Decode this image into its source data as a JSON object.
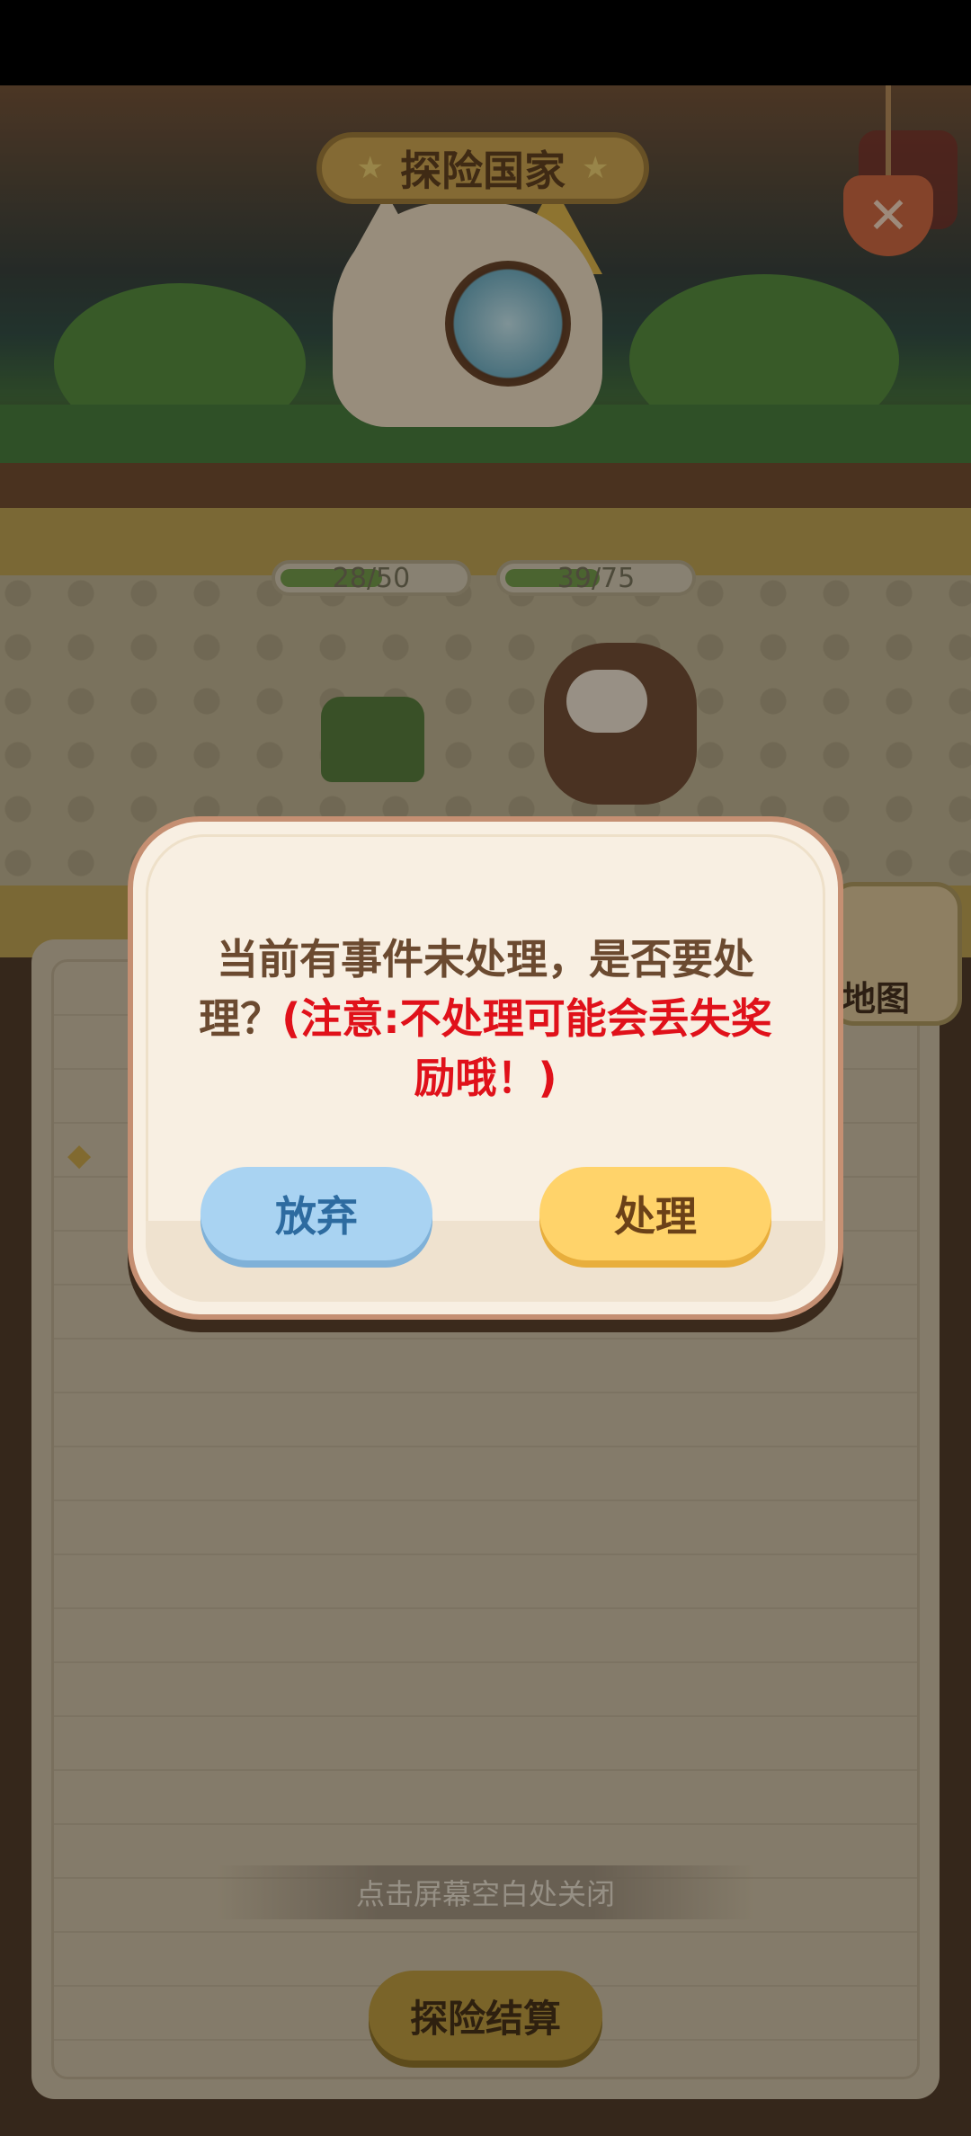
{
  "header": {
    "title": "探险国家"
  },
  "battle": {
    "enemy_hp": {
      "text": "28/50",
      "current": 28,
      "max": 50
    },
    "player_hp": {
      "text": "39/75",
      "current": 39,
      "max": 75
    }
  },
  "side": {
    "map_label": "地图"
  },
  "panel": {
    "hint": "点击屏幕空白处关闭",
    "settle_label": "探险结算"
  },
  "dialog": {
    "message": "当前有事件未处理，是否要处理？",
    "warning": "(注意:不处理可能会丢失奖励哦！)",
    "abandon_label": "放弃",
    "handle_label": "处理"
  },
  "colors": {
    "warning": "#e0111a",
    "abandon_button": "#a9d3f2",
    "handle_button": "#ffd36a"
  }
}
